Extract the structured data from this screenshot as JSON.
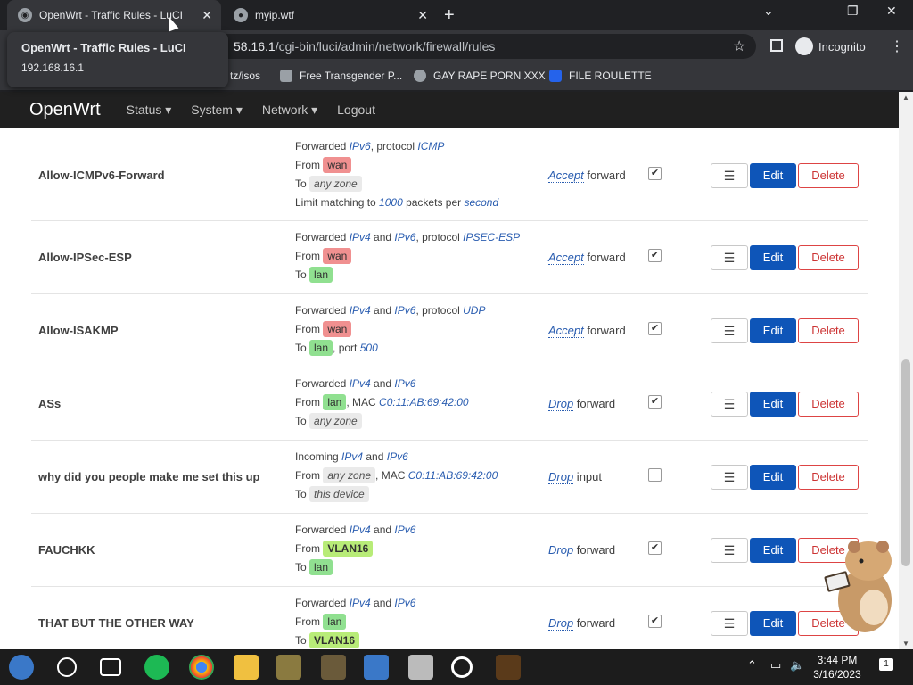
{
  "browser": {
    "tabs": [
      {
        "title": "OpenWrt - Traffic Rules - LuCI",
        "active": true
      },
      {
        "title": "myip.wtf",
        "active": false
      }
    ],
    "url_host": "192.168.16.1",
    "url_host_visible": "58.16.1",
    "url_path": "/cgi-bin/luci/admin/network/firewall/rules",
    "incognito_label": "Incognito",
    "tooltip": {
      "title": "OpenWrt - Traffic Rules - LuCI",
      "url": "192.168.16.1"
    },
    "bookmarks": [
      {
        "label": "tz/isos"
      },
      {
        "label": "Free Transgender P..."
      },
      {
        "label": "GAY RAPE PORN XXX"
      },
      {
        "label": "FILE ROULETTE"
      }
    ]
  },
  "nav": {
    "brand": "OpenWrt",
    "items": [
      "Status ▾",
      "System ▾",
      "Network ▾",
      "Logout"
    ]
  },
  "rules": [
    {
      "name": "Allow-ICMPv6-Forward",
      "lines": [
        [
          {
            "t": "Forwarded "
          },
          {
            "i": "IPv6"
          },
          {
            "t": ", protocol "
          },
          {
            "i": "ICMP"
          }
        ],
        [
          {
            "t": "From "
          },
          {
            "p": "wan",
            "c": "wan"
          }
        ],
        [
          {
            "t": "To "
          },
          {
            "p": "any zone",
            "c": "any"
          }
        ],
        [
          {
            "t": "Limit matching to "
          },
          {
            "i": "1000"
          },
          {
            "t": " packets per "
          },
          {
            "i": "second"
          }
        ]
      ],
      "action": "Accept",
      "action_suffix": " forward",
      "enabled": true
    },
    {
      "name": "Allow-IPSec-ESP",
      "lines": [
        [
          {
            "t": "Forwarded "
          },
          {
            "i": "IPv4"
          },
          {
            "t": " and "
          },
          {
            "i": "IPv6"
          },
          {
            "t": ", protocol "
          },
          {
            "i": "IPSEC-ESP"
          }
        ],
        [
          {
            "t": "From "
          },
          {
            "p": "wan",
            "c": "wan"
          }
        ],
        [
          {
            "t": "To "
          },
          {
            "p": "lan",
            "c": "lan"
          }
        ]
      ],
      "action": "Accept",
      "action_suffix": " forward",
      "enabled": true
    },
    {
      "name": "Allow-ISAKMP",
      "lines": [
        [
          {
            "t": "Forwarded "
          },
          {
            "i": "IPv4"
          },
          {
            "t": " and "
          },
          {
            "i": "IPv6"
          },
          {
            "t": ", protocol "
          },
          {
            "i": "UDP"
          }
        ],
        [
          {
            "t": "From "
          },
          {
            "p": "wan",
            "c": "wan"
          }
        ],
        [
          {
            "t": "To "
          },
          {
            "p": "lan",
            "c": "lan"
          },
          {
            "t": ", port "
          },
          {
            "i": "500"
          }
        ]
      ],
      "action": "Accept",
      "action_suffix": " forward",
      "enabled": true
    },
    {
      "name": "ASs",
      "lines": [
        [
          {
            "t": "Forwarded "
          },
          {
            "i": "IPv4"
          },
          {
            "t": " and "
          },
          {
            "i": "IPv6"
          }
        ],
        [
          {
            "t": "From "
          },
          {
            "p": "lan",
            "c": "lan"
          },
          {
            "t": ", MAC "
          },
          {
            "i": "C0:11:AB:69:42:00"
          }
        ],
        [
          {
            "t": "To "
          },
          {
            "p": "any zone",
            "c": "any"
          }
        ]
      ],
      "action": "Drop",
      "action_suffix": " forward",
      "enabled": true
    },
    {
      "name": "why did you people make me set this up",
      "lines": [
        [
          {
            "t": "Incoming "
          },
          {
            "i": "IPv4"
          },
          {
            "t": " and "
          },
          {
            "i": "IPv6"
          }
        ],
        [
          {
            "t": "From "
          },
          {
            "p": "any zone",
            "c": "any"
          },
          {
            "t": ", MAC "
          },
          {
            "i": "C0:11:AB:69:42:00"
          }
        ],
        [
          {
            "t": "To "
          },
          {
            "p": "this device",
            "c": "any"
          }
        ]
      ],
      "action": "Drop",
      "action_suffix": " input",
      "enabled": false
    },
    {
      "name": "FAUCHKK",
      "lines": [
        [
          {
            "t": "Forwarded "
          },
          {
            "i": "IPv4"
          },
          {
            "t": " and "
          },
          {
            "i": "IPv6"
          }
        ],
        [
          {
            "t": "From "
          },
          {
            "p": "VLAN16",
            "c": "vlan"
          }
        ],
        [
          {
            "t": "To "
          },
          {
            "p": "lan",
            "c": "lan"
          }
        ]
      ],
      "action": "Drop",
      "action_suffix": " forward",
      "enabled": true
    },
    {
      "name": "THAT BUT THE OTHER WAY",
      "lines": [
        [
          {
            "t": "Forwarded "
          },
          {
            "i": "IPv4"
          },
          {
            "t": " and "
          },
          {
            "i": "IPv6"
          }
        ],
        [
          {
            "t": "From "
          },
          {
            "p": "lan",
            "c": "lan"
          }
        ],
        [
          {
            "t": "To "
          },
          {
            "p": "VLAN16",
            "c": "vlan"
          }
        ]
      ],
      "action": "Drop",
      "action_suffix": " forward",
      "enabled": true
    }
  ],
  "buttons": {
    "drag": "☰",
    "edit": "Edit",
    "delete": "Delete"
  },
  "taskbar": {
    "time": "3:44 PM",
    "date": "3/16/2023",
    "notifications": "1"
  }
}
